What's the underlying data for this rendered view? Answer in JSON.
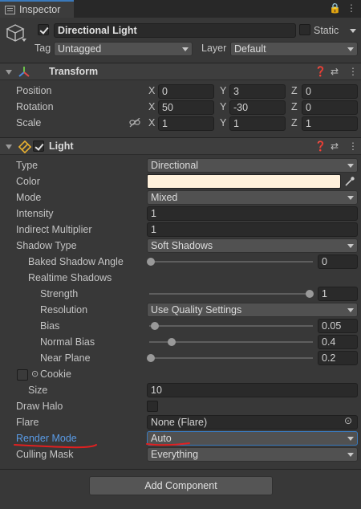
{
  "tab": {
    "title": "Inspector",
    "lock_glyph": "🔒",
    "menu_glyph": "⋮"
  },
  "object": {
    "name": "Directional Light",
    "static_label": "Static",
    "tag_label": "Tag",
    "tag_value": "Untagged",
    "layer_label": "Layer",
    "layer_value": "Default"
  },
  "transform": {
    "title": "Transform",
    "rows": [
      {
        "label": "Position",
        "x": "0",
        "y": "3",
        "z": "0"
      },
      {
        "label": "Rotation",
        "x": "50",
        "y": "-30",
        "z": "0"
      },
      {
        "label": "Scale",
        "x": "1",
        "y": "1",
        "z": "1"
      }
    ]
  },
  "axes": {
    "x": "X",
    "y": "Y",
    "z": "Z"
  },
  "light": {
    "title": "Light",
    "type_label": "Type",
    "type_value": "Directional",
    "color_label": "Color",
    "color_value": "#fff1dc",
    "mode_label": "Mode",
    "mode_value": "Mixed",
    "intensity_label": "Intensity",
    "intensity_value": "1",
    "indirect_label": "Indirect Multiplier",
    "indirect_value": "1",
    "shadow_type_label": "Shadow Type",
    "shadow_type_value": "Soft Shadows",
    "baked_angle_label": "Baked Shadow Angle",
    "baked_angle_value": "0",
    "realtime_label": "Realtime Shadows",
    "strength_label": "Strength",
    "strength_value": "1",
    "resolution_label": "Resolution",
    "resolution_value": "Use Quality Settings",
    "bias_label": "Bias",
    "bias_value": "0.05",
    "normal_bias_label": "Normal Bias",
    "normal_bias_value": "0.4",
    "near_plane_label": "Near Plane",
    "near_plane_value": "0.2",
    "cookie_label": "Cookie",
    "size_label": "Size",
    "size_value": "10",
    "draw_halo_label": "Draw Halo",
    "flare_label": "Flare",
    "flare_value": "None (Flare)",
    "render_mode_label": "Render Mode",
    "render_mode_value": "Auto",
    "culling_mask_label": "Culling Mask",
    "culling_mask_value": "Everything"
  },
  "add_component_label": "Add Component",
  "colors": {
    "accent": "#3a79bb",
    "annotation": "#e02020",
    "render_mode_label": "#5a9be6"
  }
}
